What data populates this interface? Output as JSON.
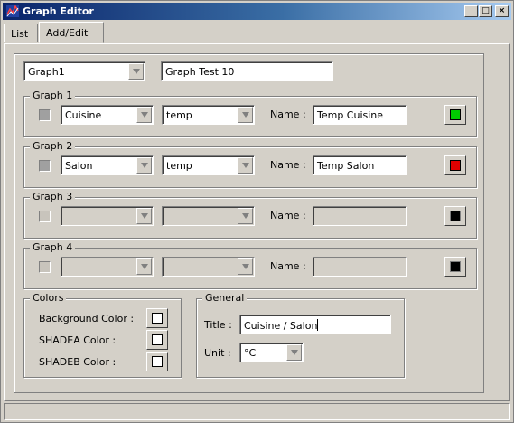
{
  "window": {
    "title": "Graph Editor",
    "minimize_label": "_",
    "maximize_label": "□",
    "close_label": "×"
  },
  "tabs": [
    {
      "label": "List",
      "active": false
    },
    {
      "label": "Add/Edit",
      "active": true
    }
  ],
  "graph_select": {
    "value": "Graph1"
  },
  "graph_title_field": {
    "value": "Graph Test 10"
  },
  "name_label": "Name :",
  "graphs": [
    {
      "legend": "Graph 1",
      "room": "Cuisine",
      "sensor": "temp",
      "name": "Temp Cuisine",
      "color": "#00cc00",
      "checked": true
    },
    {
      "legend": "Graph 2",
      "room": "Salon",
      "sensor": "temp",
      "name": "Temp Salon",
      "color": "#e00000",
      "checked": true
    },
    {
      "legend": "Graph 3",
      "room": "",
      "sensor": "",
      "name": "",
      "color": "#000000",
      "checked": false
    },
    {
      "legend": "Graph 4",
      "room": "",
      "sensor": "",
      "name": "",
      "color": "#000000",
      "checked": false
    }
  ],
  "colors": {
    "legend": "Colors",
    "background_label": "Background Color :",
    "shadea_label": "SHADEA Color :",
    "shadeb_label": "SHADEB Color :",
    "background_value": "#ffffff",
    "shadea_value": "#ffffff",
    "shadeb_value": "#ffffff"
  },
  "general": {
    "legend": "General",
    "title_label": "Title :",
    "title_value": "Cuisine / Salon",
    "unit_label": "Unit :",
    "unit_value": "°C"
  }
}
